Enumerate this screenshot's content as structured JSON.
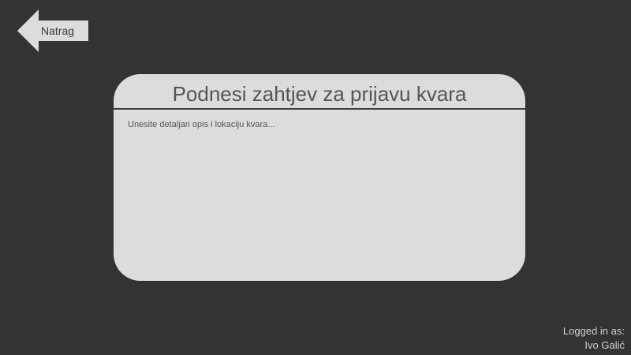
{
  "nav": {
    "back_label": "Natrag"
  },
  "form": {
    "title": "Podnesi zahtjev za prijavu kvara",
    "description_placeholder": "Unesite detaljan opis i lokaciju kvara...",
    "description_value": ""
  },
  "user": {
    "logged_in_label": "Logged in as:",
    "name": "Ivo Galić"
  },
  "colors": {
    "background": "#333333",
    "card": "#dcdcdc",
    "back_arrow": "#dcdcdc",
    "divider": "#3c3c3c"
  },
  "icons": {
    "back": "left-arrow-icon"
  }
}
